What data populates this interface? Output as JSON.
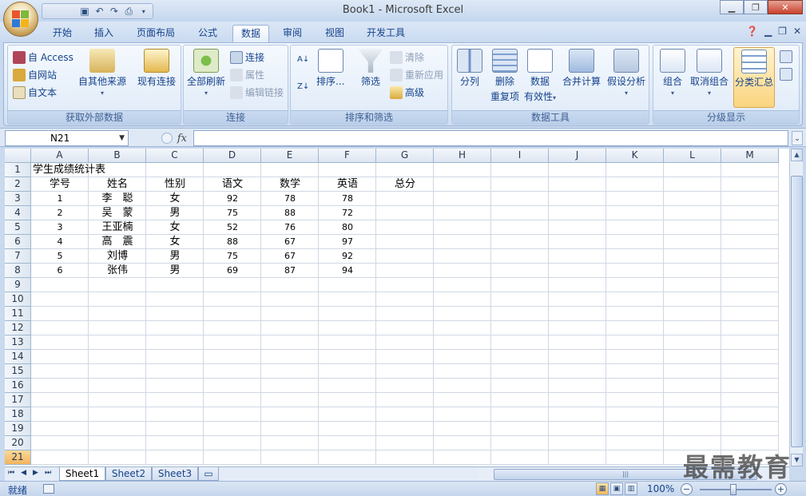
{
  "window": {
    "title": "Book1 - Microsoft Excel"
  },
  "tabs": [
    "开始",
    "插入",
    "页面布局",
    "公式",
    "数据",
    "审阅",
    "视图",
    "开发工具"
  ],
  "active_tab": "数据",
  "ribbon": {
    "get_external": {
      "label": "获取外部数据",
      "access": "自 Access",
      "web": "自网站",
      "text": "自文本",
      "other": "自其他来源",
      "existing": "现有连接"
    },
    "connections": {
      "label": "连接",
      "refresh_all": "全部刷新",
      "connections": "连接",
      "properties": "属性",
      "edit_links": "编辑链接"
    },
    "sort_filter": {
      "label": "排序和筛选",
      "sort": "排序...",
      "filter": "筛选",
      "clear": "清除",
      "reapply": "重新应用",
      "advanced": "高级"
    },
    "data_tools": {
      "label": "数据工具",
      "text_to_columns": "分列",
      "remove_dup_1": "删除",
      "remove_dup_2": "重复项",
      "validation_1": "数据",
      "validation_2": "有效性",
      "consolidate": "合并计算",
      "what_if": "假设分析"
    },
    "outline": {
      "label": "分级显示",
      "group": "组合",
      "ungroup": "取消组合",
      "subtotal": "分类汇总"
    }
  },
  "formula_bar": {
    "name_box": "N21",
    "fx": "fx",
    "formula": ""
  },
  "grid": {
    "columns": [
      "A",
      "B",
      "C",
      "D",
      "E",
      "F",
      "G",
      "H",
      "I",
      "J",
      "K",
      "L",
      "M"
    ],
    "rows": [
      "1",
      "2",
      "3",
      "4",
      "5",
      "6",
      "7",
      "8",
      "9",
      "10",
      "11",
      "12",
      "13",
      "14",
      "15",
      "16",
      "17",
      "18",
      "19",
      "20",
      "21"
    ],
    "selected_row": "21",
    "title": "学生成绩统计表",
    "headers": [
      "学号",
      "姓名",
      "性别",
      "语文",
      "数学",
      "英语",
      "总分"
    ],
    "records": [
      [
        "1",
        "李　聪",
        "女",
        "92",
        "78",
        "78"
      ],
      [
        "2",
        "吴　蒙",
        "男",
        "75",
        "88",
        "72"
      ],
      [
        "3",
        "王亚楠",
        "女",
        "52",
        "76",
        "80"
      ],
      [
        "4",
        "高　震",
        "女",
        "88",
        "67",
        "97"
      ],
      [
        "5",
        "刘博",
        "男",
        "75",
        "67",
        "92"
      ],
      [
        "6",
        "张伟",
        "男",
        "69",
        "87",
        "94"
      ]
    ]
  },
  "sheets": [
    "Sheet1",
    "Sheet2",
    "Sheet3"
  ],
  "active_sheet": "Sheet1",
  "status": {
    "ready": "就绪",
    "zoom": "100%"
  },
  "watermark": "最需教育"
}
